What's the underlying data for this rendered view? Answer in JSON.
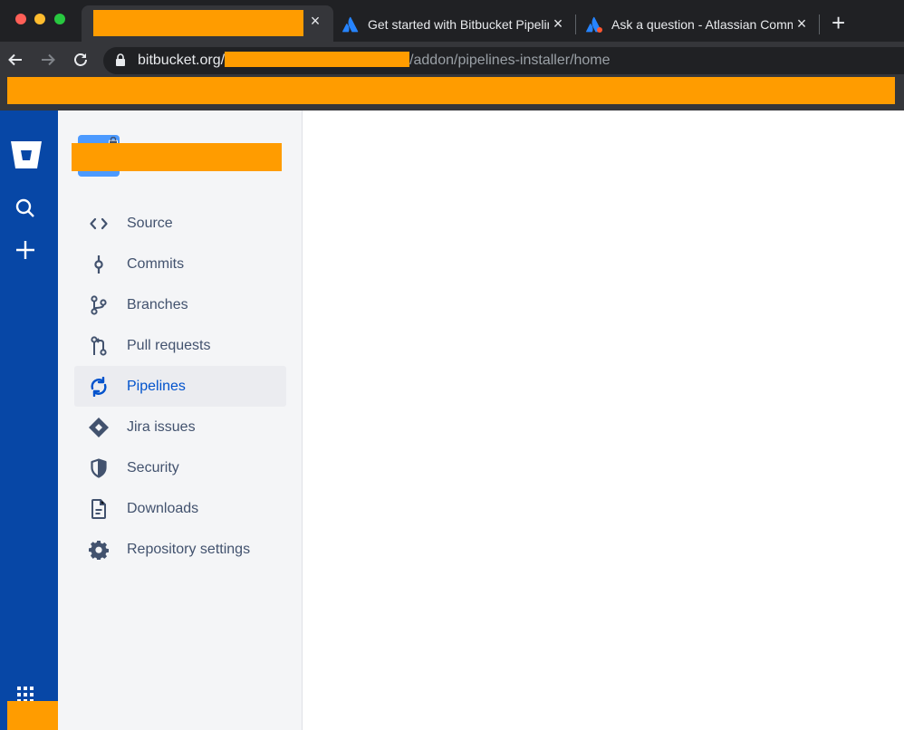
{
  "browser": {
    "tabs": [
      {
        "title": "",
        "redacted": true
      },
      {
        "title": "Get started with Bitbucket Pipelines",
        "icon": "atlassian-logo-icon"
      },
      {
        "title": "Ask a question - Atlassian Community",
        "icon": "atlassian-community-icon"
      }
    ],
    "new_tab_label": "+",
    "close_glyph": "×",
    "url_host": "bitbucket.org/",
    "url_path": "/addon/pipelines-installer/home"
  },
  "sidebar": {
    "repo_name": "",
    "items": [
      {
        "label": "Source",
        "icon": "code-icon"
      },
      {
        "label": "Commits",
        "icon": "commit-icon"
      },
      {
        "label": "Branches",
        "icon": "branch-icon"
      },
      {
        "label": "Pull requests",
        "icon": "pull-request-icon"
      },
      {
        "label": "Pipelines",
        "icon": "pipelines-icon",
        "active": true
      },
      {
        "label": "Jira issues",
        "icon": "jira-icon"
      },
      {
        "label": "Security",
        "icon": "shield-icon"
      },
      {
        "label": "Downloads",
        "icon": "document-icon"
      },
      {
        "label": "Repository settings",
        "icon": "gear-icon"
      }
    ]
  },
  "colors": {
    "global_nav": "#0747a6",
    "sidebar_bg": "#f4f5f7",
    "active_text": "#0052cc",
    "text": "#42526e",
    "redaction": "#ff9c00"
  }
}
